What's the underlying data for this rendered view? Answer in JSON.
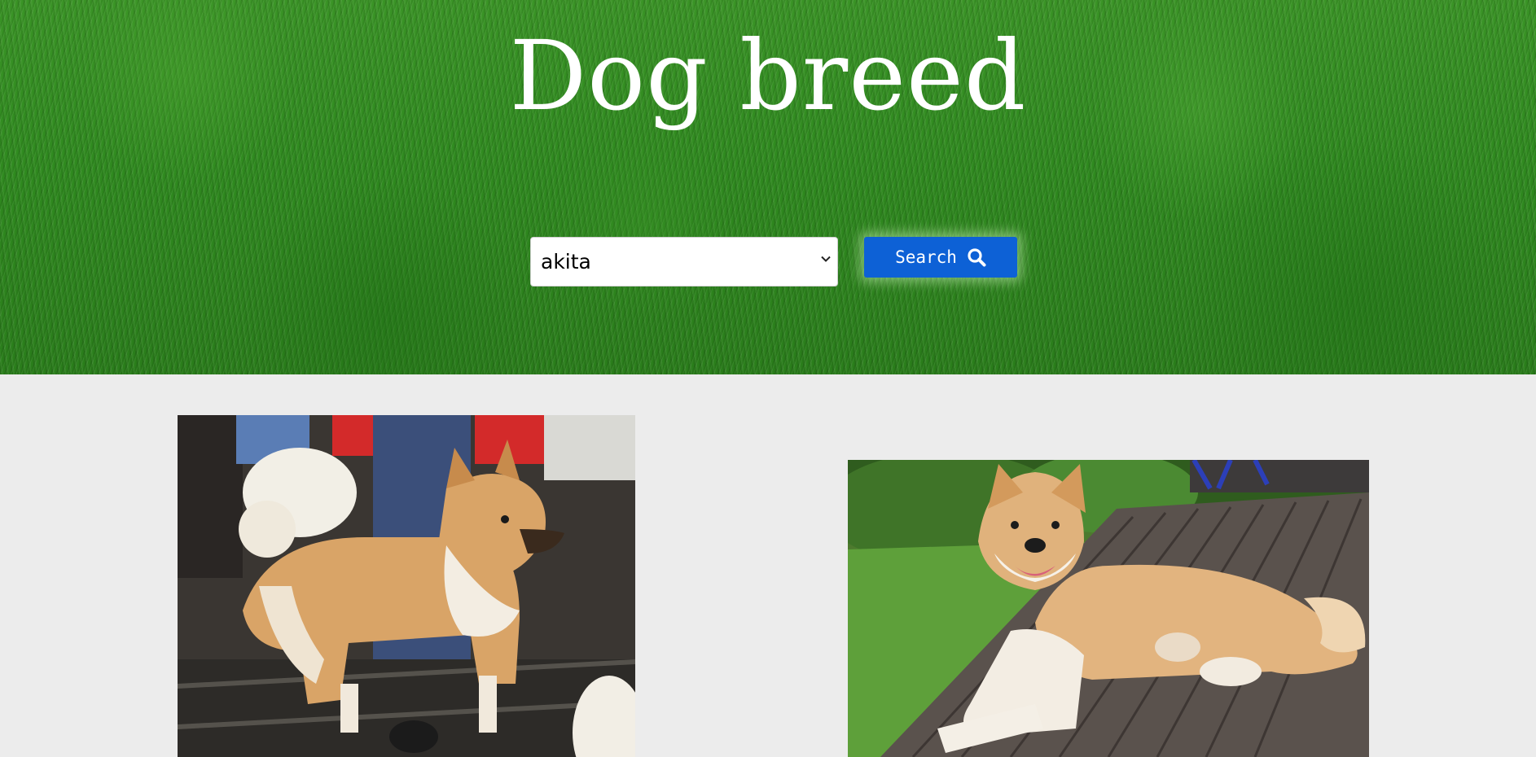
{
  "header": {
    "title": "Dog breed"
  },
  "search": {
    "selected_breed": "akita",
    "button_label": "Search"
  },
  "icons": {
    "search": "search-icon",
    "dropdown": "chevron-down-icon"
  },
  "colors": {
    "button": "#0d61d6",
    "page_background": "#ececec",
    "header_background": "#2f8a1f"
  }
}
